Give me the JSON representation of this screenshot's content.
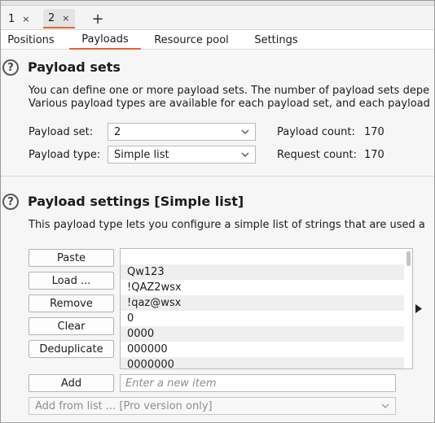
{
  "request_tabs": [
    {
      "label": "1",
      "close": "×"
    },
    {
      "label": "2",
      "close": "×"
    }
  ],
  "add_tab": "+",
  "section_tabs": [
    "Positions",
    "Payloads",
    "Resource pool",
    "Settings"
  ],
  "active_section_tab": "Payloads",
  "accent_color": "#e8642c",
  "payload_sets": {
    "help_icon": "?",
    "title": "Payload sets",
    "description_line1": "You can define one or more payload sets. The number of payload sets depe",
    "description_line2": "Various payload types are available for each payload set, and each payload",
    "payload_set_label": "Payload set:",
    "payload_set_value": "2",
    "payload_type_label": "Payload type:",
    "payload_type_value": "Simple list",
    "payload_count_label": "Payload count:",
    "payload_count_value": "170",
    "request_count_label": "Request count:",
    "request_count_value": "170"
  },
  "payload_settings": {
    "help_icon": "?",
    "title": "Payload settings [Simple list]",
    "description": "This payload type lets you configure a simple list of strings that are used a",
    "buttons": {
      "paste": "Paste",
      "load": "Load ...",
      "remove": "Remove",
      "clear": "Clear",
      "deduplicate": "Deduplicate",
      "add": "Add"
    },
    "list_items": [
      "",
      "Qw123",
      "!QAZ2wsx",
      "!qaz@wsx",
      "0",
      "0000",
      "000000",
      "0000000"
    ],
    "add_input_placeholder": "Enter a new item",
    "add_from_list": "Add from list ... [Pro version only]"
  }
}
